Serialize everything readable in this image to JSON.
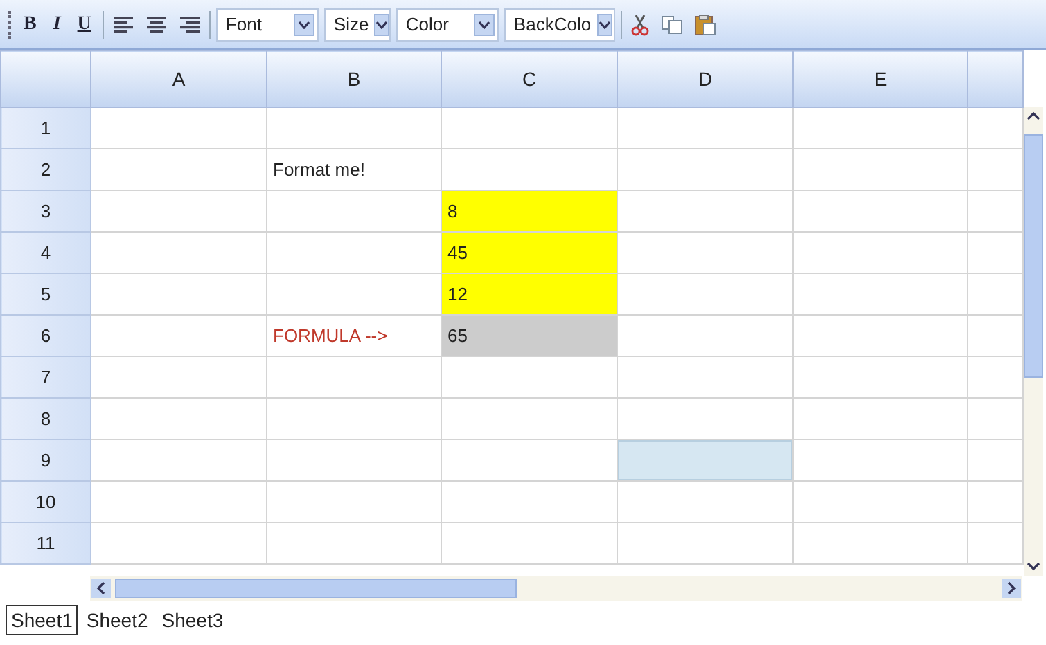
{
  "toolbar": {
    "format_buttons": [
      {
        "label": "B",
        "kind": "bold"
      },
      {
        "label": "I",
        "kind": "italic"
      },
      {
        "label": "U",
        "kind": "underline"
      }
    ],
    "align_buttons": [
      {
        "kind": "left"
      },
      {
        "kind": "center"
      },
      {
        "kind": "right"
      }
    ],
    "dropdowns": [
      {
        "label": "Font"
      },
      {
        "label": "Size"
      },
      {
        "label": "Color"
      },
      {
        "label": "BackColo"
      }
    ],
    "edit_buttons": [
      {
        "kind": "cut"
      },
      {
        "kind": "copy"
      },
      {
        "kind": "paste"
      }
    ]
  },
  "sheet": {
    "columns": [
      "A",
      "B",
      "C",
      "D",
      "E"
    ],
    "rows": [
      {
        "label": "1",
        "cells": [
          {
            "selected": false
          },
          {
            "selected": false
          },
          {
            "selected": false
          },
          {
            "selected": false
          },
          {
            "selected": false
          },
          {
            "selected": false
          }
        ]
      },
      {
        "label": "2",
        "cells": [
          {
            "selected": false
          },
          {
            "text": "Format me!",
            "kind": "text",
            "selected": false
          },
          {
            "selected": false
          },
          {
            "selected": false
          },
          {
            "selected": false
          },
          {
            "selected": false
          }
        ]
      },
      {
        "label": "3",
        "cells": [
          {
            "selected": false
          },
          {
            "selected": false
          },
          {
            "text": "8",
            "kind": "text",
            "color": "#ffff00",
            "selected": false
          },
          {
            "selected": false
          },
          {
            "selected": false
          },
          {
            "selected": false
          }
        ]
      },
      {
        "label": "4",
        "cells": [
          {
            "selected": false
          },
          {
            "selected": false
          },
          {
            "text": "45",
            "kind": "text",
            "color": "#ffff00",
            "selected": false
          },
          {
            "selected": false
          },
          {
            "selected": false
          },
          {
            "selected": false
          }
        ]
      },
      {
        "label": "5",
        "cells": [
          {
            "selected": false
          },
          {
            "selected": false
          },
          {
            "text": "12",
            "kind": "text",
            "color": "#ffff00",
            "selected": false
          },
          {
            "selected": false
          },
          {
            "selected": false
          },
          {
            "selected": false
          }
        ]
      },
      {
        "label": "6",
        "cells": [
          {
            "selected": false
          },
          {
            "text": "FORMULA -->",
            "kind": "formula",
            "selected": false
          },
          {
            "text": "65",
            "kind": "text",
            "color": "#cccccc",
            "selected": false
          },
          {
            "selected": false
          },
          {
            "selected": false
          },
          {
            "selected": false
          }
        ]
      },
      {
        "label": "7",
        "cells": [
          {
            "selected": false
          },
          {
            "selected": false
          },
          {
            "selected": false
          },
          {
            "selected": false
          },
          {
            "selected": false
          },
          {
            "selected": false
          }
        ]
      },
      {
        "label": "8",
        "cells": [
          {
            "selected": false
          },
          {
            "selected": false
          },
          {
            "selected": false
          },
          {
            "selected": false
          },
          {
            "selected": false
          },
          {
            "selected": false
          }
        ]
      },
      {
        "label": "9",
        "cells": [
          {
            "selected": false
          },
          {
            "selected": false
          },
          {
            "selected": false
          },
          {
            "selected": true
          },
          {
            "selected": false
          },
          {
            "selected": false
          }
        ]
      },
      {
        "label": "10",
        "cells": [
          {
            "selected": false
          },
          {
            "selected": false
          },
          {
            "selected": false
          },
          {
            "selected": false
          },
          {
            "selected": false
          },
          {
            "selected": false
          }
        ]
      },
      {
        "label": "11",
        "cells": [
          {
            "selected": false
          },
          {
            "selected": false
          },
          {
            "selected": false
          },
          {
            "selected": false
          },
          {
            "selected": false
          },
          {
            "selected": false
          }
        ]
      }
    ]
  },
  "sheet_tabs": [
    {
      "label": "Sheet1",
      "selected": true
    },
    {
      "label": "Sheet2",
      "selected": false
    },
    {
      "label": "Sheet3",
      "selected": false
    }
  ]
}
